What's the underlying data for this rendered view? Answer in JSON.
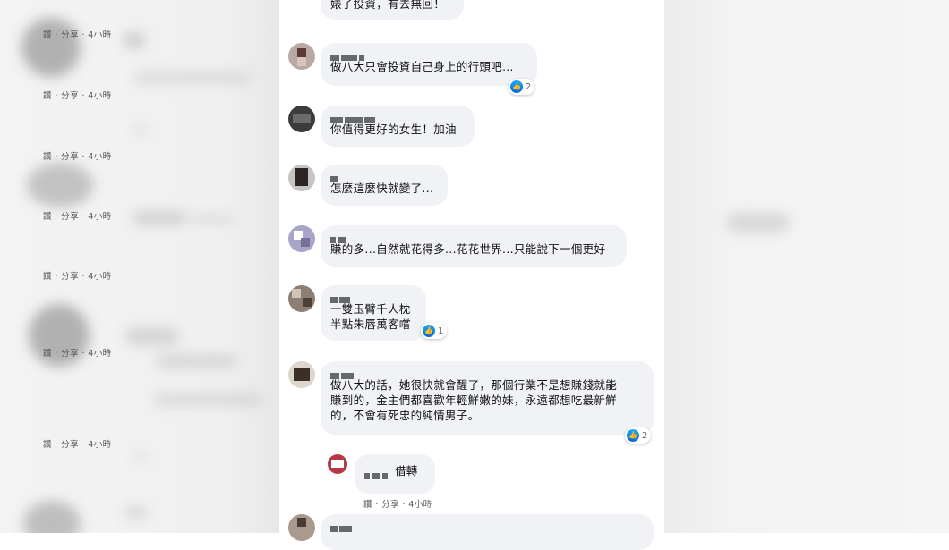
{
  "actions": {
    "like": "讚",
    "share": "分享",
    "sep": "·"
  },
  "comments": [
    {
      "text": "婊子投資，有去無回！",
      "time": "4小時"
    },
    {
      "text": "做八大只會投資自己身上的行頭吧…",
      "time": "4小時",
      "reactions": "2"
    },
    {
      "text": "你值得更好的女生！加油",
      "time": "4小時"
    },
    {
      "text": "怎麼這麼快就變了...",
      "time": "4小時"
    },
    {
      "text": "賺的多...自然就花得多...花花世界...只能說下一個更好",
      "time": "4小時"
    },
    {
      "text": "一雙玉臂千人枕\n半點朱唇萬客嚐",
      "time": "4小時",
      "reactions": "1"
    },
    {
      "text": "做八大的話，她很快就會醒了，那個行業不是想賺錢就能\n賺到的，金主們都喜歡年輕鮮嫩的妹，永遠都想吃最新鮮\n的，不會有死忠的純情男子。",
      "time": "4小時",
      "reactions": "2"
    },
    {
      "text": "借轉",
      "time": "4小時"
    }
  ],
  "colors": {
    "bubble": "#f0f2f5",
    "like_blue": "#1877f2",
    "meta_text": "#555555"
  },
  "icons": {
    "like": "thumbs-up-icon"
  }
}
